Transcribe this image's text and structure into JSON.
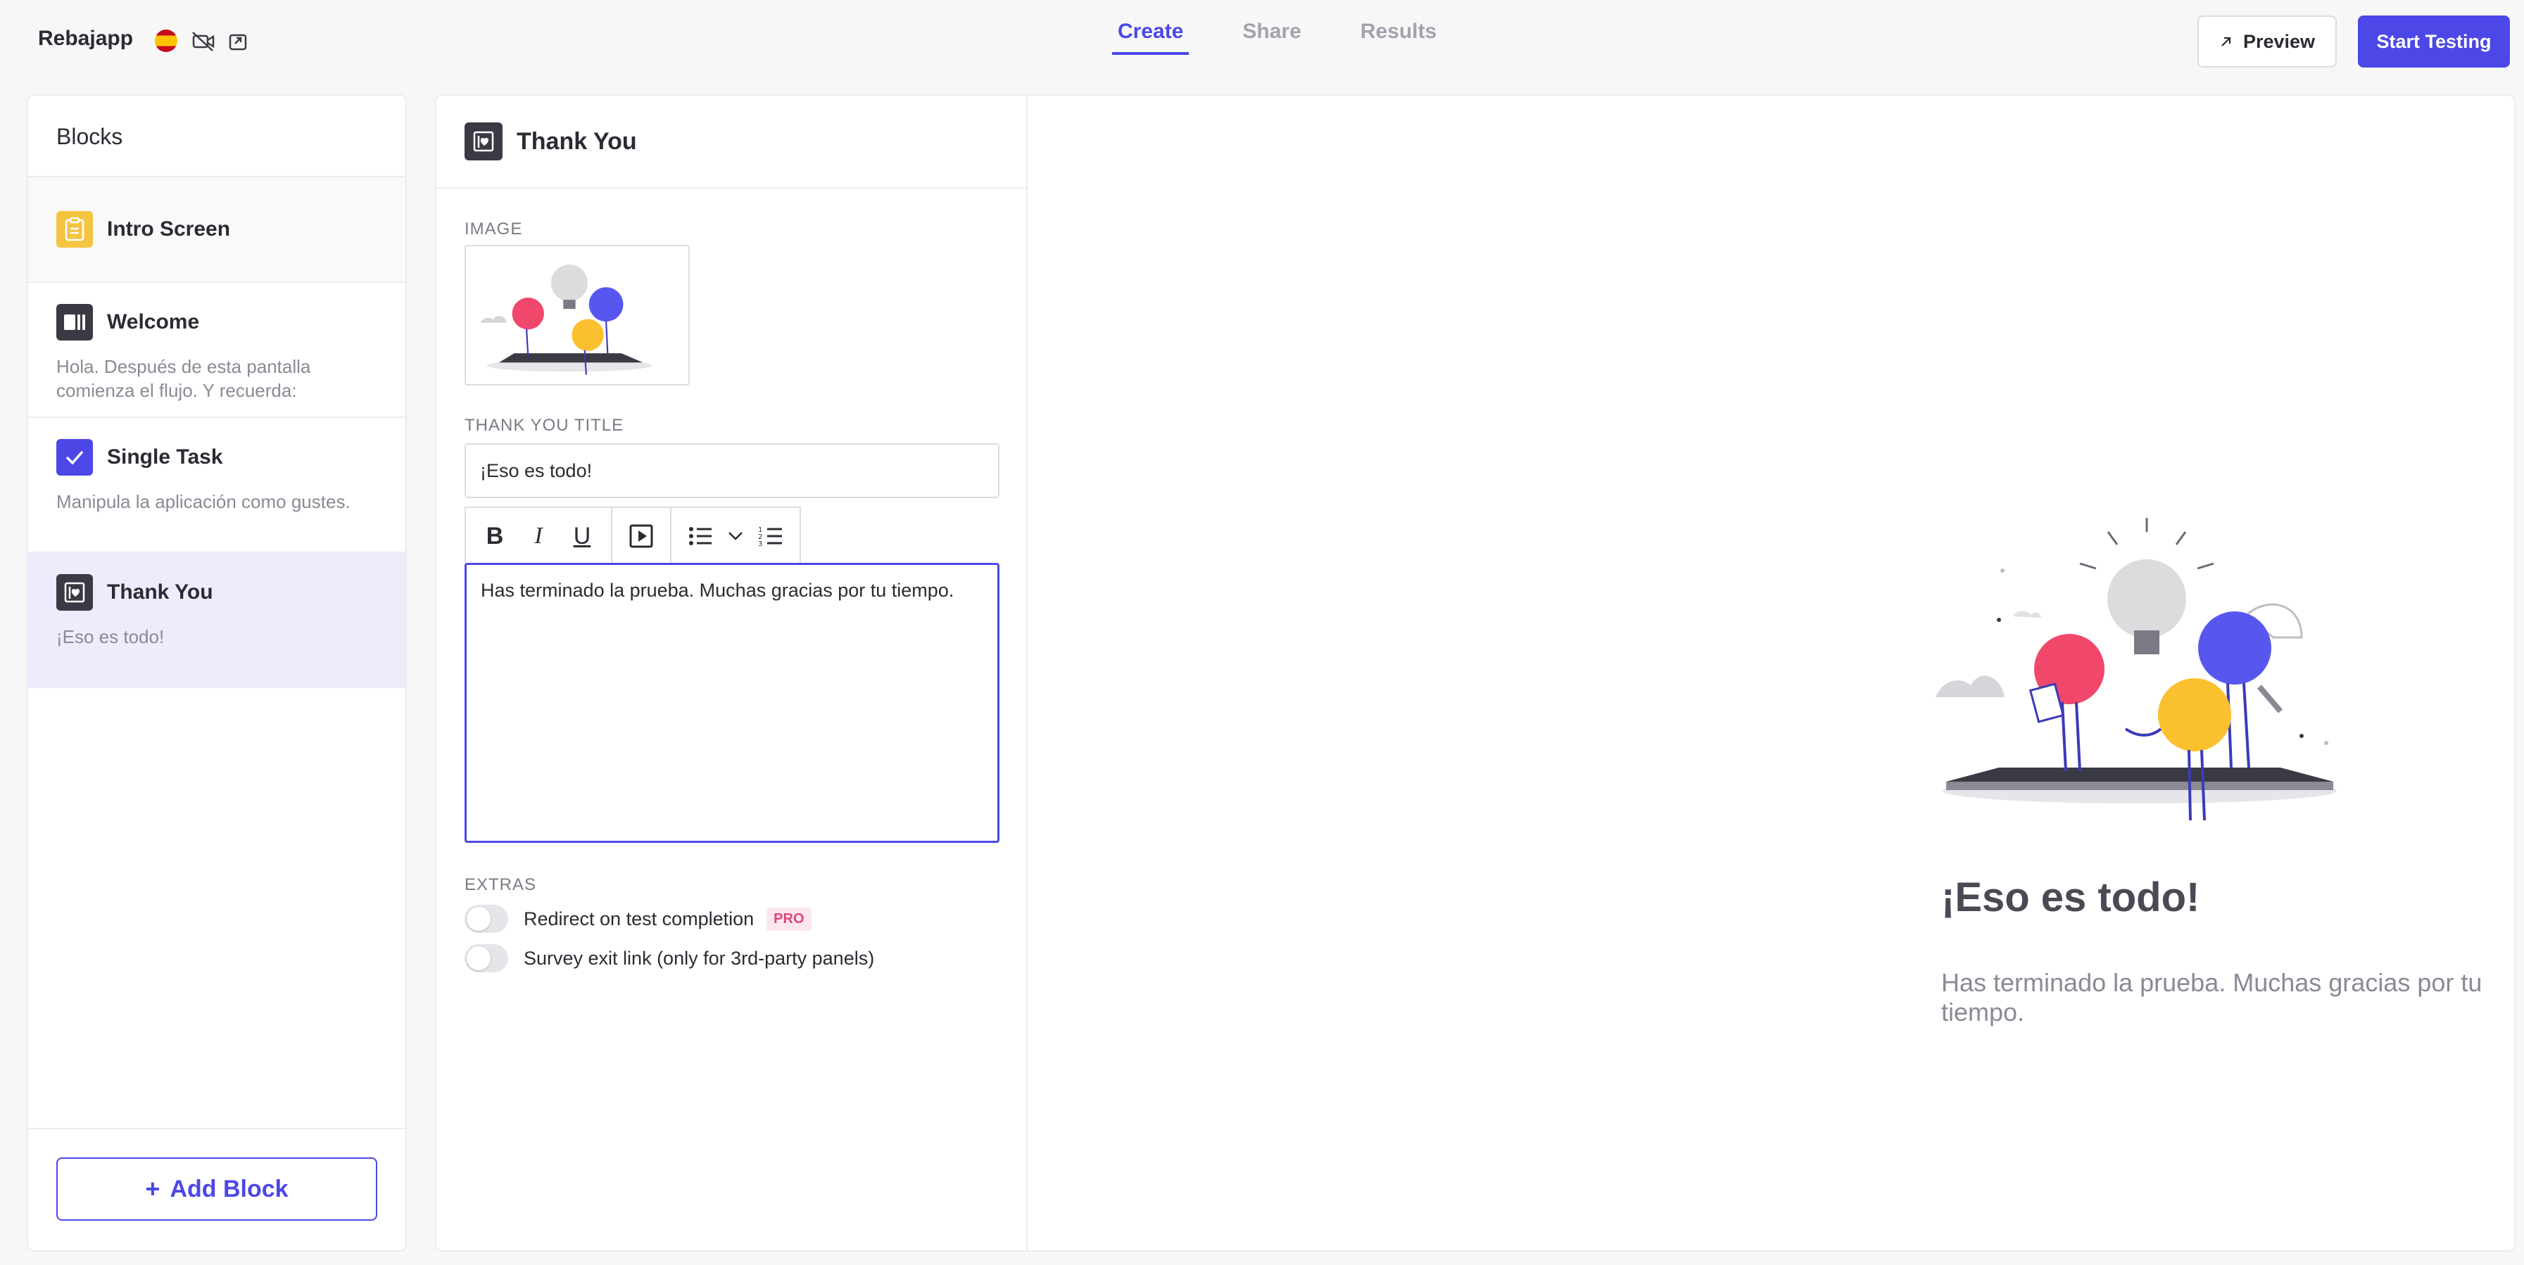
{
  "app": {
    "name": "Rebajapp"
  },
  "header": {
    "tabs": [
      {
        "label": "Create",
        "active": true
      },
      {
        "label": "Share",
        "active": false
      },
      {
        "label": "Results",
        "active": false
      }
    ],
    "preview_label": "Preview",
    "start_label": "Start Testing",
    "icons": [
      "spain-flag-icon",
      "video-off-icon",
      "export-icon",
      "arrow-up-right-icon"
    ]
  },
  "sidebar": {
    "title": "Blocks",
    "items": [
      {
        "title": "Intro Screen",
        "description": "",
        "icon": "clipboard-icon"
      },
      {
        "title": "Welcome",
        "description": "Hola. Después de esta pantalla comienza el flujo. Y recuerda:",
        "icon": "welcome-icon"
      },
      {
        "title": "Single Task",
        "description": "Manipula la aplicación como gustes.",
        "icon": "check-icon"
      },
      {
        "title": "Thank You",
        "description": "¡Eso es todo!",
        "icon": "thank-you-icon",
        "selected": true
      }
    ],
    "add_label": "Add Block"
  },
  "editor": {
    "title": "Thank You",
    "image_label": "IMAGE",
    "title_label": "THANK YOU TITLE",
    "title_value": "¡Eso es todo!",
    "body_value": "Has terminado la prueba. Muchas gracias por tu tiempo.",
    "extras_label": "EXTRAS",
    "redirect_label": "Redirect on test completion",
    "pro_badge": "PRO",
    "survey_label": "Survey exit link (only for 3rd-party panels)"
  },
  "preview": {
    "title": "¡Eso es todo!",
    "body": "Has terminado la prueba. Muchas gracias por tu tiempo."
  },
  "colors": {
    "accent": "#4c47e6",
    "intro_icon": "#f5c542",
    "selected_bg": "#ececfc",
    "pro": "#e0457b"
  }
}
